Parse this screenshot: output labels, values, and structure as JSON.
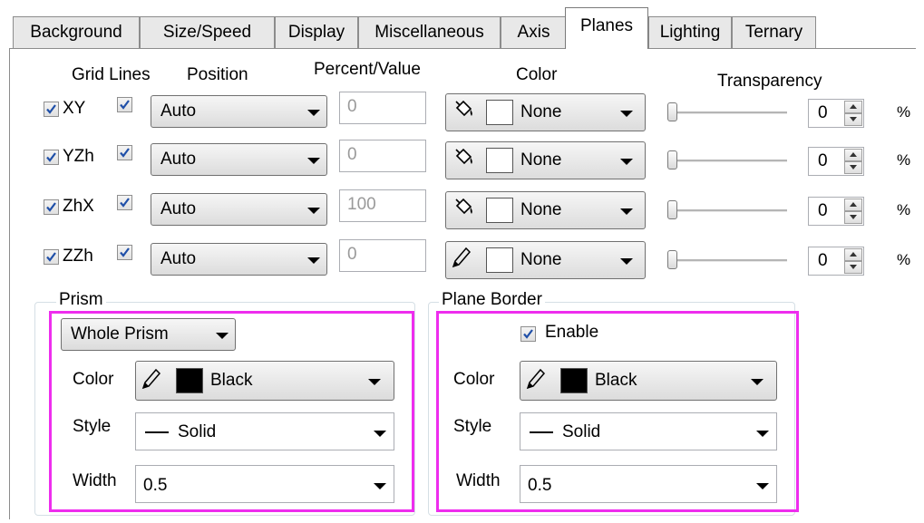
{
  "tabs": [
    "Background",
    "Size/Speed",
    "Display",
    "Miscellaneous",
    "Axis",
    "Planes",
    "Lighting",
    "Ternary"
  ],
  "active_tab": "Planes",
  "headers": {
    "grid_lines": "Grid Lines",
    "position": "Position",
    "percent_value": "Percent/Value",
    "color": "Color",
    "transparency": "Transparency"
  },
  "planes": [
    {
      "name": "XY",
      "plane_checked": true,
      "grid_checked": true,
      "position": "Auto",
      "value": "0",
      "color": "None",
      "icon": "fill-bucket-icon",
      "transparency": "0",
      "unit": "%"
    },
    {
      "name": "YZh",
      "plane_checked": true,
      "grid_checked": true,
      "position": "Auto",
      "value": "0",
      "color": "None",
      "icon": "fill-bucket-icon",
      "transparency": "0",
      "unit": "%"
    },
    {
      "name": "ZhX",
      "plane_checked": true,
      "grid_checked": true,
      "position": "Auto",
      "value": "100",
      "color": "None",
      "icon": "fill-bucket-icon",
      "transparency": "0",
      "unit": "%"
    },
    {
      "name": "ZZh",
      "plane_checked": true,
      "grid_checked": true,
      "position": "Auto",
      "value": "0",
      "color": "None",
      "icon": "pen-icon",
      "transparency": "0",
      "unit": "%"
    }
  ],
  "prism": {
    "title": "Prism",
    "mode": "Whole Prism",
    "color_label": "Color",
    "color_value": "Black",
    "color_hex": "#000000",
    "style_label": "Style",
    "style_value": "Solid",
    "width_label": "Width",
    "width_value": "0.5"
  },
  "plane_border": {
    "title": "Plane Border",
    "enable_label": "Enable",
    "enabled": true,
    "color_label": "Color",
    "color_value": "Black",
    "color_hex": "#000000",
    "style_label": "Style",
    "style_value": "Solid",
    "width_label": "Width",
    "width_value": "0.5"
  },
  "highlight_color": "#ee2dee"
}
